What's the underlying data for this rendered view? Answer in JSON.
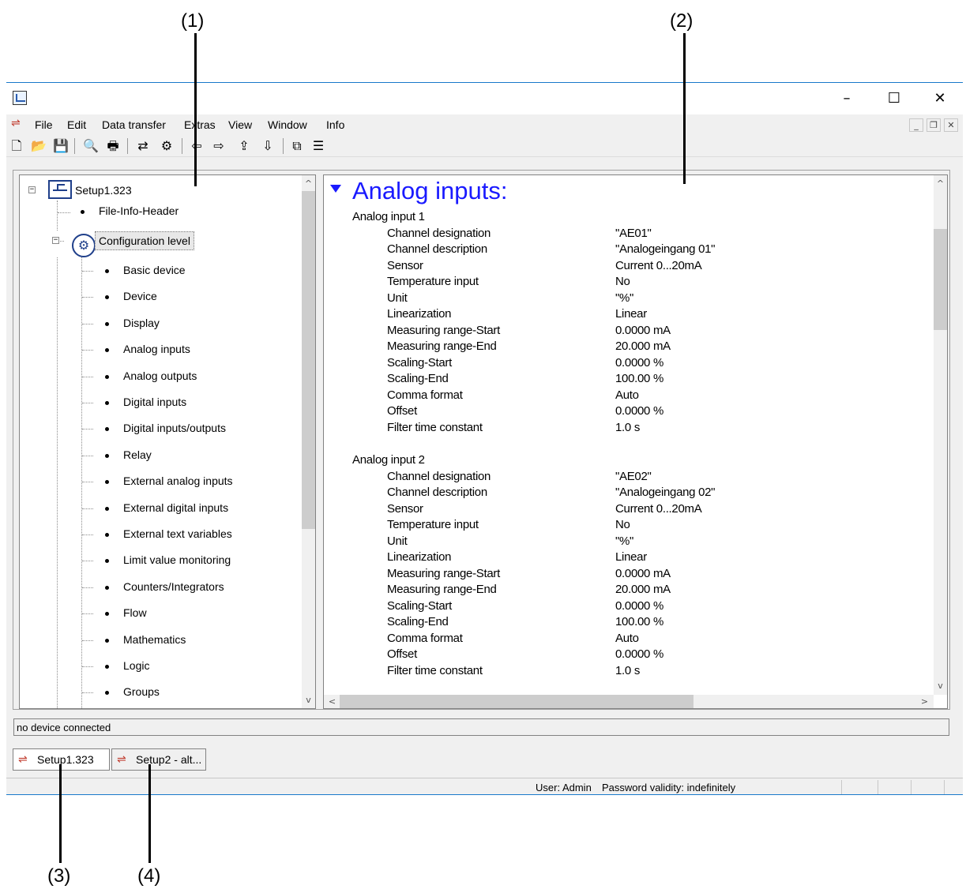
{
  "callouts": [
    "(1)",
    "(2)",
    "(3)",
    "(4)"
  ],
  "window": {
    "icon": "app-chart-icon",
    "controls": {
      "minimize": "–",
      "maximize": "☐",
      "close": "✕"
    }
  },
  "menu": {
    "items": [
      "File",
      "Edit",
      "Data transfer",
      "Extras",
      "View",
      "Window",
      "Info"
    ],
    "mdi": {
      "minimize": "_",
      "restore": "❐",
      "close": "✕"
    }
  },
  "toolbar": {
    "icons": [
      "new-file-icon",
      "open-folder-icon",
      "save-icon",
      "print-preview-icon",
      "print-icon",
      "data-transfer-icon",
      "device-icon",
      "arrow-left-icon",
      "arrow-right-icon",
      "upload-icon",
      "download-icon",
      "window-cascade-icon",
      "window-tile-icon"
    ],
    "glyphs": [
      "🗋",
      "📂",
      "💾",
      "🔍",
      "🖶",
      "⇄",
      "⚙",
      "⇦",
      "⇨",
      "⇪",
      "⇩",
      "⧉",
      "☰"
    ]
  },
  "tree": {
    "root": "Setup1.323",
    "file_info": "File-Info-Header",
    "config_level": "Configuration level",
    "children": [
      "Basic device",
      "Device",
      "Display",
      "Analog inputs",
      "Analog outputs",
      "Digital inputs",
      "Digital inputs/outputs",
      "Relay",
      "External analog inputs",
      "External digital inputs",
      "External text variables",
      "Limit value monitoring",
      "Counters/Integrators",
      "Flow",
      "Mathematics",
      "Logic",
      "Groups"
    ],
    "expander_minus": "−"
  },
  "detail": {
    "title": "Analog inputs:",
    "groups": [
      {
        "name": "Analog input 1",
        "rows": [
          {
            "label": "Channel designation",
            "value": "\"AE01\""
          },
          {
            "label": "Channel description",
            "value": "\"Analogeingang 01\""
          },
          {
            "label": "Sensor",
            "value": "Current 0...20mA"
          },
          {
            "label": "Temperature input",
            "value": "No"
          },
          {
            "label": "Unit",
            "value": "\"%\""
          },
          {
            "label": "Linearization",
            "value": "Linear"
          },
          {
            "label": "Measuring range-Start",
            "value": "0.0000 mA"
          },
          {
            "label": "Measuring range-End",
            "value": "20.000 mA"
          },
          {
            "label": "Scaling-Start",
            "value": "0.0000 %"
          },
          {
            "label": "Scaling-End",
            "value": "100.00 %"
          },
          {
            "label": "Comma format",
            "value": "Auto"
          },
          {
            "label": "Offset",
            "value": "0.0000 %"
          },
          {
            "label": "Filter time constant",
            "value": "1.0 s"
          }
        ]
      },
      {
        "name": "Analog input 2",
        "rows": [
          {
            "label": "Channel designation",
            "value": "\"AE02\""
          },
          {
            "label": "Channel description",
            "value": "\"Analogeingang 02\""
          },
          {
            "label": "Sensor",
            "value": "Current 0...20mA"
          },
          {
            "label": "Temperature input",
            "value": "No"
          },
          {
            "label": "Unit",
            "value": "\"%\""
          },
          {
            "label": "Linearization",
            "value": "Linear"
          },
          {
            "label": "Measuring range-Start",
            "value": "0.0000 mA"
          },
          {
            "label": "Measuring range-End",
            "value": "20.000 mA"
          },
          {
            "label": "Scaling-Start",
            "value": "0.0000 %"
          },
          {
            "label": "Scaling-End",
            "value": "100.00 %"
          },
          {
            "label": "Comma format",
            "value": "Auto"
          },
          {
            "label": "Offset",
            "value": "0.0000 %"
          },
          {
            "label": "Filter time constant",
            "value": "1.0 s"
          }
        ]
      }
    ]
  },
  "scroll": {
    "up": "^",
    "down": "v",
    "left": "<",
    "right": ">"
  },
  "status": "no device connected",
  "tabs": [
    {
      "label": "Setup1.323",
      "active": true
    },
    {
      "label": "Setup2 - alt...",
      "active": false
    }
  ],
  "bottombar": {
    "user": "User: Admin",
    "password": "Password validity: indefinitely"
  },
  "colors": {
    "accent": "#1a1aff",
    "window_border": "#1979ca",
    "icon_red": "#c0392b",
    "icon_blue": "#1f3f8a"
  }
}
